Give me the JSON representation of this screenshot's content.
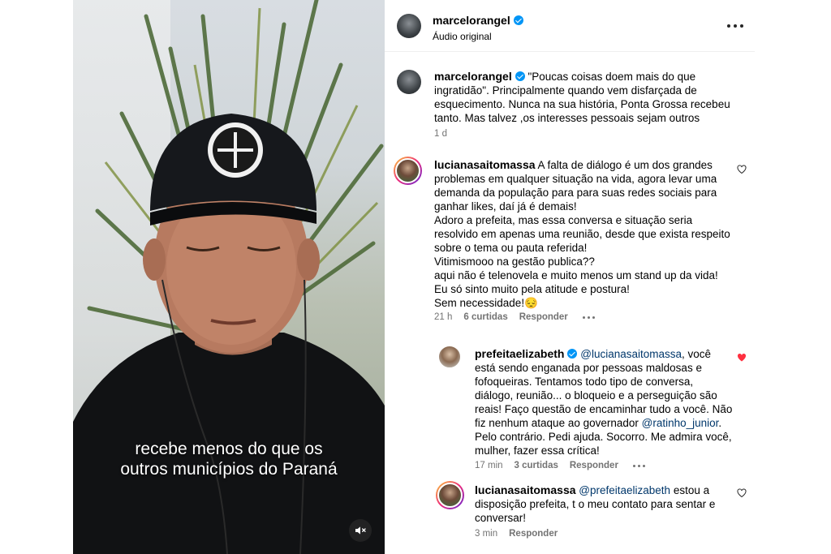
{
  "video": {
    "caption_line1": "recebe menos do que os",
    "caption_line2": "outros municípios do Paraná",
    "mute_icon": "speaker-muted-icon"
  },
  "post": {
    "author": "marcelorangel",
    "audio_label": "Áudio original",
    "verified": true,
    "more_icon": "more-horizontal-icon"
  },
  "caption": {
    "author": "marcelorangel",
    "text": "\"Poucas coisas doem mais do que ingratidão\". Principalmente quando vem disfarçada de esquecimento. Nunca na sua história, Ponta Grossa recebeu tanto. Mas talvez ,os interesses pessoais sejam outros",
    "time": "1 d"
  },
  "comments": [
    {
      "author": "lucianasaitomassa",
      "text": "A falta de diálogo é um dos grandes problemas em qualquer situação na vida, agora levar uma demanda da população para para suas redes sociais para ganhar likes, daí já é demais!\nAdoro a prefeita, mas essa conversa e situação seria resolvido em apenas uma reunião, desde que exista respeito sobre o tema ou pauta referida!\nVitimismooo na gestão publica??\naqui não é telenovela e muito menos um stand up da vida!\nEu só sinto muito pela atitude e postura!\nSem necessidade!😔",
      "time": "21 h",
      "likes": "6 curtidas",
      "reply_label": "Responder",
      "liked": false
    }
  ],
  "replies": [
    {
      "author": "prefeitaelizabeth",
      "verified": true,
      "mention": "@lucianasaitomassa",
      "text_before_mention2": ", você está sendo enganada por pessoas maldosas e fofoqueiras. Tentamos todo tipo de conversa, diálogo, reunião... o bloqueio e a perseguição são reais! Faço questão de encaminhar tudo a você. Não fiz nenhum ataque ao governador ",
      "mention2": "@ratinho_junior",
      "text_after": ". Pelo contrário. Pedi ajuda. Socorro. Me admira você, mulher, fazer essa crítica!",
      "time": "17 min",
      "likes": "3 curtidas",
      "reply_label": "Responder",
      "liked": true
    },
    {
      "author": "lucianasaitomassa",
      "mention": "@prefeitaelizabeth",
      "text": " estou a disposição prefeita, t o meu contato para sentar e conversar!",
      "time": "3 min",
      "reply_label": "Responder",
      "liked": false
    }
  ],
  "colors": {
    "like_red": "#ff3040",
    "verified_blue": "#0095f6",
    "mention_blue": "#00376b",
    "meta_gray": "#737373"
  }
}
